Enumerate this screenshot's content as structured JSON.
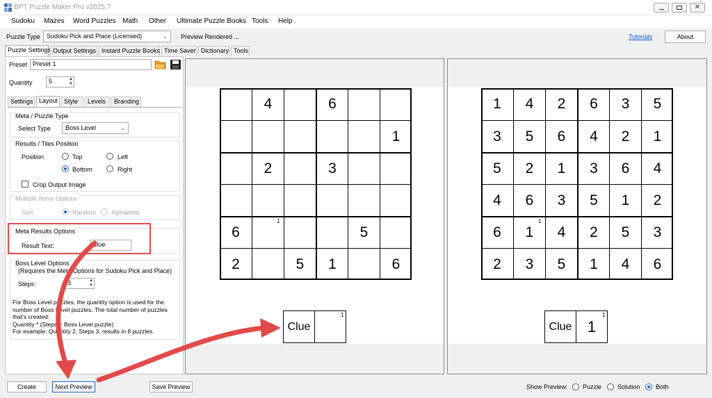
{
  "window": {
    "title": "BPT Puzzle Maker Pro v2025.7"
  },
  "menu": [
    "Sudoku",
    "Mazes",
    "Word Puzzles",
    "Math",
    "Other",
    "Ultimate Puzzle Books",
    "Tools",
    "Help"
  ],
  "toolbar": {
    "puzzle_type_label": "Puzzle Type",
    "puzzle_type_value": "Sudoku Pick and Place (Licensed)",
    "status": "Preview Rendered ...",
    "tutorials": "Tutorials",
    "about": "About"
  },
  "main_tabs": [
    "Puzzle Settings",
    "Output Settings",
    "Instant Puzzle Books",
    "Time Saver",
    "Dictionary",
    "Tools"
  ],
  "settings": {
    "preset_label": "Preset",
    "preset_value": "Preset 1",
    "quantity_label": "Quantity",
    "quantity_value": "5",
    "sub_tabs": [
      "Settings",
      "Layout",
      "Style",
      "Levels",
      "Branding"
    ],
    "meta_group": "Meta / Puzzle Type",
    "select_type_label": "Select Type",
    "select_type_value": "Boss Level",
    "results_group": "Results / Tiles Position",
    "position_label": "Position",
    "pos_top": "Top",
    "pos_left": "Left",
    "pos_bottom": "Bottom",
    "pos_right": "Right",
    "crop_label": "Crop Output Image",
    "multi_group": "Multiple Items Options",
    "sort_label": "Sort",
    "sort_random": "Random",
    "sort_alpha": "Alphabetic",
    "meta_results_group": "Meta Results Options",
    "result_text_label": "Result Text:",
    "result_text_value": "Clue",
    "boss_group": "Boss Level Options",
    "boss_requires": "(Requires the Meta Options for Sudoku Pick and Place)",
    "steps_label": "Steps:",
    "steps_value": "3",
    "help_lines": [
      "For Boss Level puzzles, the quantity option is used for the",
      "number of Boss Level puzzles. The total number of puzzles",
      "that's created:",
      "Quantity * (Steps + Boss Level puzzle)",
      "For example: Quantity 2, Steps 3, results in 8 puzzles."
    ]
  },
  "puzzle": {
    "grid": [
      [
        "",
        "4",
        "",
        "6",
        "",
        ""
      ],
      [
        "",
        "",
        "",
        "",
        "",
        "1"
      ],
      [
        "",
        "2",
        "",
        "3",
        "",
        ""
      ],
      [
        "",
        "",
        "",
        "",
        "",
        ""
      ],
      [
        "6",
        "",
        "",
        "",
        "5",
        ""
      ],
      [
        "2",
        "",
        "5",
        "1",
        "",
        "6"
      ]
    ],
    "marker": "1",
    "clue_label": "Clue",
    "clue_value": "",
    "clue_marker": "1"
  },
  "solution": {
    "grid": [
      [
        "1",
        "4",
        "2",
        "6",
        "3",
        "5"
      ],
      [
        "3",
        "5",
        "6",
        "4",
        "2",
        "1"
      ],
      [
        "5",
        "2",
        "1",
        "3",
        "6",
        "4"
      ],
      [
        "4",
        "6",
        "3",
        "5",
        "1",
        "2"
      ],
      [
        "6",
        "1",
        "4",
        "2",
        "5",
        "3"
      ],
      [
        "2",
        "3",
        "5",
        "1",
        "4",
        "6"
      ]
    ],
    "marker": "1",
    "clue_label": "Clue",
    "clue_value": "1",
    "clue_marker": "1"
  },
  "bottom": {
    "create": "Create",
    "next_preview": "Next Preview",
    "save_preview": "Save Preview",
    "show_preview_label": "Show Preview:",
    "opt_puzzle": "Puzzle",
    "opt_solution": "Solution",
    "opt_both": "Both"
  },
  "colors": {
    "highlight": "#e24a4a",
    "accent": "#1a5fc4"
  }
}
